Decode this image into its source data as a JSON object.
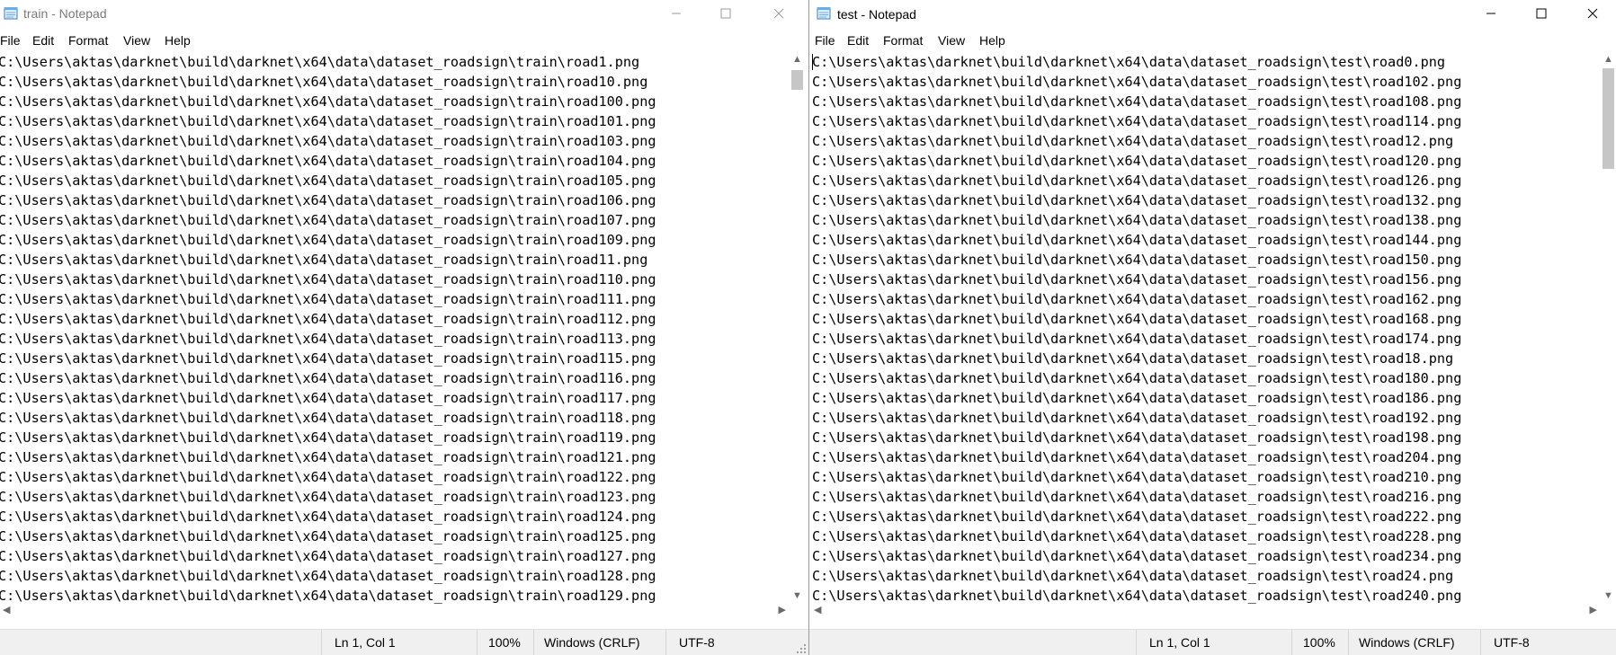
{
  "windows": [
    {
      "id": "train",
      "title": "train - Notepad",
      "active": false,
      "menu": [
        "File",
        "Edit",
        "Format",
        "View",
        "Help"
      ],
      "lines": [
        "C:\\Users\\aktas\\darknet\\build\\darknet\\x64\\data\\dataset_roadsign\\train\\road1.png",
        "C:\\Users\\aktas\\darknet\\build\\darknet\\x64\\data\\dataset_roadsign\\train\\road10.png",
        "C:\\Users\\aktas\\darknet\\build\\darknet\\x64\\data\\dataset_roadsign\\train\\road100.png",
        "C:\\Users\\aktas\\darknet\\build\\darknet\\x64\\data\\dataset_roadsign\\train\\road101.png",
        "C:\\Users\\aktas\\darknet\\build\\darknet\\x64\\data\\dataset_roadsign\\train\\road103.png",
        "C:\\Users\\aktas\\darknet\\build\\darknet\\x64\\data\\dataset_roadsign\\train\\road104.png",
        "C:\\Users\\aktas\\darknet\\build\\darknet\\x64\\data\\dataset_roadsign\\train\\road105.png",
        "C:\\Users\\aktas\\darknet\\build\\darknet\\x64\\data\\dataset_roadsign\\train\\road106.png",
        "C:\\Users\\aktas\\darknet\\build\\darknet\\x64\\data\\dataset_roadsign\\train\\road107.png",
        "C:\\Users\\aktas\\darknet\\build\\darknet\\x64\\data\\dataset_roadsign\\train\\road109.png",
        "C:\\Users\\aktas\\darknet\\build\\darknet\\x64\\data\\dataset_roadsign\\train\\road11.png",
        "C:\\Users\\aktas\\darknet\\build\\darknet\\x64\\data\\dataset_roadsign\\train\\road110.png",
        "C:\\Users\\aktas\\darknet\\build\\darknet\\x64\\data\\dataset_roadsign\\train\\road111.png",
        "C:\\Users\\aktas\\darknet\\build\\darknet\\x64\\data\\dataset_roadsign\\train\\road112.png",
        "C:\\Users\\aktas\\darknet\\build\\darknet\\x64\\data\\dataset_roadsign\\train\\road113.png",
        "C:\\Users\\aktas\\darknet\\build\\darknet\\x64\\data\\dataset_roadsign\\train\\road115.png",
        "C:\\Users\\aktas\\darknet\\build\\darknet\\x64\\data\\dataset_roadsign\\train\\road116.png",
        "C:\\Users\\aktas\\darknet\\build\\darknet\\x64\\data\\dataset_roadsign\\train\\road117.png",
        "C:\\Users\\aktas\\darknet\\build\\darknet\\x64\\data\\dataset_roadsign\\train\\road118.png",
        "C:\\Users\\aktas\\darknet\\build\\darknet\\x64\\data\\dataset_roadsign\\train\\road119.png",
        "C:\\Users\\aktas\\darknet\\build\\darknet\\x64\\data\\dataset_roadsign\\train\\road121.png",
        "C:\\Users\\aktas\\darknet\\build\\darknet\\x64\\data\\dataset_roadsign\\train\\road122.png",
        "C:\\Users\\aktas\\darknet\\build\\darknet\\x64\\data\\dataset_roadsign\\train\\road123.png",
        "C:\\Users\\aktas\\darknet\\build\\darknet\\x64\\data\\dataset_roadsign\\train\\road124.png",
        "C:\\Users\\aktas\\darknet\\build\\darknet\\x64\\data\\dataset_roadsign\\train\\road125.png",
        "C:\\Users\\aktas\\darknet\\build\\darknet\\x64\\data\\dataset_roadsign\\train\\road127.png",
        "C:\\Users\\aktas\\darknet\\build\\darknet\\x64\\data\\dataset_roadsign\\train\\road128.png",
        "C:\\Users\\aktas\\darknet\\build\\darknet\\x64\\data\\dataset_roadsign\\train\\road129.png"
      ],
      "status": {
        "position": "Ln 1, Col 1",
        "zoom": "100%",
        "line_ending": "Windows (CRLF)",
        "encoding": "UTF-8"
      }
    },
    {
      "id": "test",
      "title": "test - Notepad",
      "active": true,
      "menu": [
        "File",
        "Edit",
        "Format",
        "View",
        "Help"
      ],
      "lines": [
        "C:\\Users\\aktas\\darknet\\build\\darknet\\x64\\data\\dataset_roadsign\\test\\road0.png",
        "C:\\Users\\aktas\\darknet\\build\\darknet\\x64\\data\\dataset_roadsign\\test\\road102.png",
        "C:\\Users\\aktas\\darknet\\build\\darknet\\x64\\data\\dataset_roadsign\\test\\road108.png",
        "C:\\Users\\aktas\\darknet\\build\\darknet\\x64\\data\\dataset_roadsign\\test\\road114.png",
        "C:\\Users\\aktas\\darknet\\build\\darknet\\x64\\data\\dataset_roadsign\\test\\road12.png",
        "C:\\Users\\aktas\\darknet\\build\\darknet\\x64\\data\\dataset_roadsign\\test\\road120.png",
        "C:\\Users\\aktas\\darknet\\build\\darknet\\x64\\data\\dataset_roadsign\\test\\road126.png",
        "C:\\Users\\aktas\\darknet\\build\\darknet\\x64\\data\\dataset_roadsign\\test\\road132.png",
        "C:\\Users\\aktas\\darknet\\build\\darknet\\x64\\data\\dataset_roadsign\\test\\road138.png",
        "C:\\Users\\aktas\\darknet\\build\\darknet\\x64\\data\\dataset_roadsign\\test\\road144.png",
        "C:\\Users\\aktas\\darknet\\build\\darknet\\x64\\data\\dataset_roadsign\\test\\road150.png",
        "C:\\Users\\aktas\\darknet\\build\\darknet\\x64\\data\\dataset_roadsign\\test\\road156.png",
        "C:\\Users\\aktas\\darknet\\build\\darknet\\x64\\data\\dataset_roadsign\\test\\road162.png",
        "C:\\Users\\aktas\\darknet\\build\\darknet\\x64\\data\\dataset_roadsign\\test\\road168.png",
        "C:\\Users\\aktas\\darknet\\build\\darknet\\x64\\data\\dataset_roadsign\\test\\road174.png",
        "C:\\Users\\aktas\\darknet\\build\\darknet\\x64\\data\\dataset_roadsign\\test\\road18.png",
        "C:\\Users\\aktas\\darknet\\build\\darknet\\x64\\data\\dataset_roadsign\\test\\road180.png",
        "C:\\Users\\aktas\\darknet\\build\\darknet\\x64\\data\\dataset_roadsign\\test\\road186.png",
        "C:\\Users\\aktas\\darknet\\build\\darknet\\x64\\data\\dataset_roadsign\\test\\road192.png",
        "C:\\Users\\aktas\\darknet\\build\\darknet\\x64\\data\\dataset_roadsign\\test\\road198.png",
        "C:\\Users\\aktas\\darknet\\build\\darknet\\x64\\data\\dataset_roadsign\\test\\road204.png",
        "C:\\Users\\aktas\\darknet\\build\\darknet\\x64\\data\\dataset_roadsign\\test\\road210.png",
        "C:\\Users\\aktas\\darknet\\build\\darknet\\x64\\data\\dataset_roadsign\\test\\road216.png",
        "C:\\Users\\aktas\\darknet\\build\\darknet\\x64\\data\\dataset_roadsign\\test\\road222.png",
        "C:\\Users\\aktas\\darknet\\build\\darknet\\x64\\data\\dataset_roadsign\\test\\road228.png",
        "C:\\Users\\aktas\\darknet\\build\\darknet\\x64\\data\\dataset_roadsign\\test\\road234.png",
        "C:\\Users\\aktas\\darknet\\build\\darknet\\x64\\data\\dataset_roadsign\\test\\road24.png",
        "C:\\Users\\aktas\\darknet\\build\\darknet\\x64\\data\\dataset_roadsign\\test\\road240.png"
      ],
      "status": {
        "position": "Ln 1, Col 1",
        "zoom": "100%",
        "line_ending": "Windows (CRLF)",
        "encoding": "UTF-8"
      }
    }
  ],
  "icons": {
    "app": "notepad-icon",
    "minimize": "minimize-icon",
    "maximize": "maximize-icon",
    "close": "close-icon",
    "scroll_up": "chevron-up-icon",
    "scroll_down": "chevron-down-icon",
    "scroll_left": "chevron-left-icon",
    "scroll_right": "chevron-right-icon",
    "resize": "resize-grip-icon"
  },
  "colors": {
    "background": "#ffffff",
    "statusbar": "#f0f0f0",
    "scroll_thumb": "#c6c6c6",
    "inactive_title": "#7a7a7a"
  }
}
